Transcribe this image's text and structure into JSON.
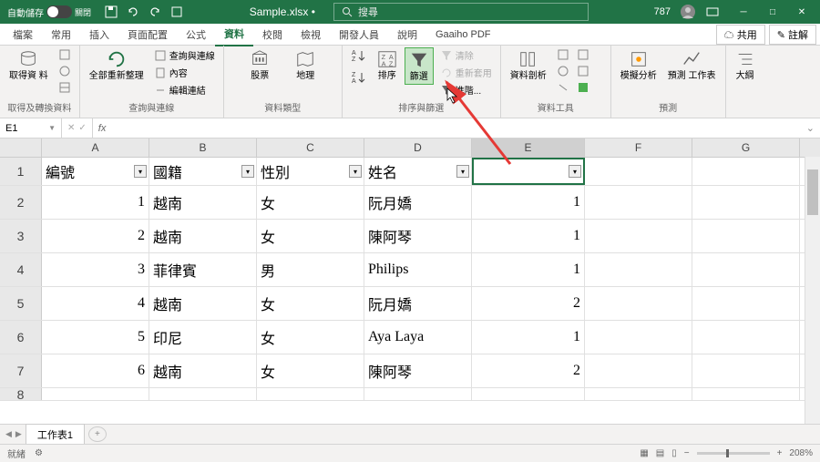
{
  "titlebar": {
    "autosave_label": "自動儲存",
    "autosave_state": "關閉",
    "filename": "Sample.xlsx •",
    "search_placeholder": "搜尋",
    "user_badge": "787"
  },
  "tabs": {
    "file": "檔案",
    "home": "常用",
    "insert": "插入",
    "layout": "頁面配置",
    "formulas": "公式",
    "data": "資料",
    "review": "校閱",
    "view": "檢視",
    "developer": "開發人員",
    "help": "說明",
    "gaaiho": "Gaaiho PDF",
    "share": "共用",
    "comments": "註解"
  },
  "ribbon": {
    "group1_big": "取得資\n料",
    "group1_label": "取得及轉換資料",
    "group2_big": "全部重新整理",
    "group2_s1": "查詢與連線",
    "group2_s2": "內容",
    "group2_s3": "編輯連結",
    "group2_label": "查詢與連線",
    "group3_stock": "股票",
    "group3_geo": "地理",
    "group3_label": "資料類型",
    "group4_sort": "排序",
    "group4_filter": "篩選",
    "group4_s1": "清除",
    "group4_s2": "重新套用",
    "group4_s3": "進階...",
    "group4_label": "排序與篩選",
    "group5_big": "資料剖析",
    "group5_label": "資料工具",
    "group6_a": "模擬分析",
    "group6_b": "預測\n工作表",
    "group6_label": "預測",
    "group7_big": "大綱"
  },
  "formula": {
    "name_box": "E1"
  },
  "grid": {
    "cols": [
      "A",
      "B",
      "C",
      "D",
      "E",
      "F",
      "G"
    ],
    "rows": [
      {
        "n": "1",
        "A": "編號",
        "B": "國籍",
        "C": "性別",
        "D": "姓名",
        "E": "",
        "headers": true
      },
      {
        "n": "2",
        "A": "1",
        "B": "越南",
        "C": "女",
        "D": "阮月嬌",
        "E": "1"
      },
      {
        "n": "3",
        "A": "2",
        "B": "越南",
        "C": "女",
        "D": "陳阿琴",
        "E": "1"
      },
      {
        "n": "4",
        "A": "3",
        "B": "菲律賓",
        "C": "男",
        "D": "Philips",
        "E": "1"
      },
      {
        "n": "5",
        "A": "4",
        "B": "越南",
        "C": "女",
        "D": "阮月嬌",
        "E": "2"
      },
      {
        "n": "6",
        "A": "5",
        "B": "印尼",
        "C": "女",
        "D": "Aya Laya",
        "E": "1"
      },
      {
        "n": "7",
        "A": "6",
        "B": "越南",
        "C": "女",
        "D": "陳阿琴",
        "E": "2"
      },
      {
        "n": "8",
        "A": "",
        "B": "",
        "C": "",
        "D": "",
        "E": ""
      }
    ]
  },
  "sheet": {
    "tab1": "工作表1"
  },
  "status": {
    "ready": "就緒",
    "zoom": "208%"
  }
}
